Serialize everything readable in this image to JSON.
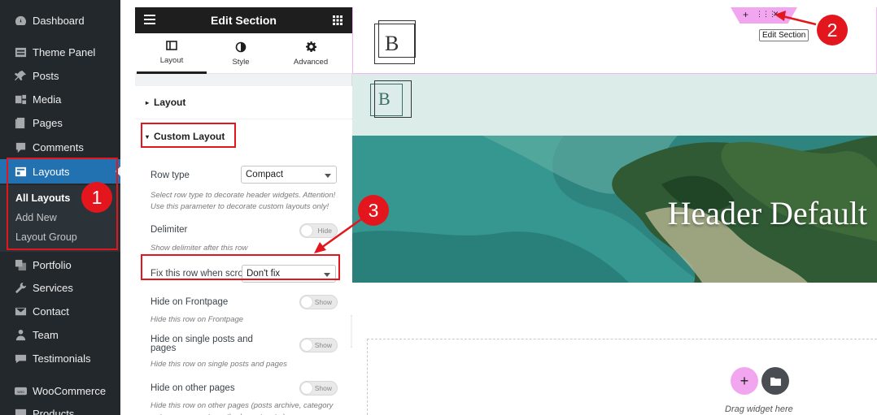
{
  "wp_menu": {
    "items": [
      {
        "label": "Dashboard",
        "icon": "dashboard-icon"
      },
      {
        "label": "Theme Panel",
        "icon": "theme-panel-icon"
      },
      {
        "label": "Posts",
        "icon": "pin-icon"
      },
      {
        "label": "Media",
        "icon": "media-icon"
      },
      {
        "label": "Pages",
        "icon": "pages-icon"
      },
      {
        "label": "Comments",
        "icon": "comment-icon"
      },
      {
        "label": "Layouts",
        "icon": "layouts-icon"
      },
      {
        "label": "Portfolio",
        "icon": "portfolio-icon"
      },
      {
        "label": "Services",
        "icon": "wrench-icon"
      },
      {
        "label": "Contact",
        "icon": "envelope-icon"
      },
      {
        "label": "Team",
        "icon": "team-icon"
      },
      {
        "label": "Testimonials",
        "icon": "quote-icon"
      },
      {
        "label": "WooCommerce",
        "icon": "woo-icon"
      },
      {
        "label": "Products",
        "icon": "products-icon"
      }
    ],
    "submenu": [
      "All Layouts",
      "Add New",
      "Layout Group"
    ]
  },
  "panel": {
    "title": "Edit Section",
    "tabs": [
      "Layout",
      "Style",
      "Advanced"
    ],
    "section_layout": "Layout",
    "section_custom": "Custom Layout",
    "row_type_label": "Row type",
    "row_type_value": "Compact",
    "row_type_desc": "Select row type to decorate header widgets. Attention! Use this parameter to decorate custom layouts only!",
    "delimiter_label": "Delimiter",
    "delimiter_toggle": "Hide",
    "delimiter_desc": "Show delimiter after this row",
    "fix_label": "Fix this row when scroll",
    "fix_value": "Don't fix",
    "hide_front_label": "Hide on Frontpage",
    "hide_front_toggle": "Show",
    "hide_front_desc": "Hide this row on Frontpage",
    "hide_single_label": "Hide on single posts and pages",
    "hide_single_toggle": "Show",
    "hide_single_desc": "Hide this row on single posts and pages",
    "hide_other_label": "Hide on other pages",
    "hide_other_toggle": "Show",
    "hide_other_desc": "Hide this row on other pages (posts archive, category or taxonomy posts, author's posts, etc.)"
  },
  "canvas": {
    "logo_letter": "B",
    "hero_title": "Header Default",
    "handle_plus": "+",
    "handle_dots": "⋮⋮⋮",
    "handle_close": "×",
    "tooltip": "Edit Section",
    "drag_text": "Drag widget here",
    "add_plus": "+"
  },
  "annotations": [
    "1",
    "2",
    "3"
  ],
  "colors": {
    "accent_red": "#e3161d",
    "wp_blue": "#2271b1",
    "handle_pink": "#f2a6f0"
  }
}
